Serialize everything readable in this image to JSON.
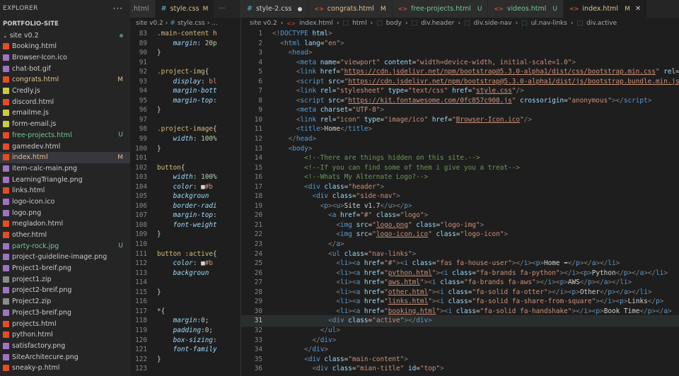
{
  "explorer": {
    "title": "EXPLORER",
    "more": "···",
    "project": "PORTFOLIO-SITE",
    "folder": "site v0.2",
    "files": [
      {
        "name": "Booking.html",
        "icon": "html",
        "status": ""
      },
      {
        "name": "Browser-Icon.ico",
        "icon": "img",
        "status": ""
      },
      {
        "name": "chat-bot.gif",
        "icon": "img",
        "status": ""
      },
      {
        "name": "congrats.html",
        "icon": "html",
        "status": "M"
      },
      {
        "name": "Credly.js",
        "icon": "js",
        "status": ""
      },
      {
        "name": "discord.html",
        "icon": "html",
        "status": ""
      },
      {
        "name": "emailme.js",
        "icon": "js",
        "status": ""
      },
      {
        "name": "form-email.js",
        "icon": "js",
        "status": ""
      },
      {
        "name": "free-projects.html",
        "icon": "html",
        "status": "U"
      },
      {
        "name": "gamedev.html",
        "icon": "html",
        "status": ""
      },
      {
        "name": "index.html",
        "icon": "html",
        "status": "M"
      },
      {
        "name": "item-calc-main.png",
        "icon": "img",
        "status": ""
      },
      {
        "name": "LearningTriangle.png",
        "icon": "img",
        "status": ""
      },
      {
        "name": "links.html",
        "icon": "html",
        "status": ""
      },
      {
        "name": "logo-icon.ico",
        "icon": "img",
        "status": ""
      },
      {
        "name": "logo.png",
        "icon": "img",
        "status": ""
      },
      {
        "name": "megladon.html",
        "icon": "html",
        "status": ""
      },
      {
        "name": "other.html",
        "icon": "html",
        "status": ""
      },
      {
        "name": "party-rock.jpg",
        "icon": "img",
        "status": "U"
      },
      {
        "name": "project-guideline-image.png",
        "icon": "img",
        "status": ""
      },
      {
        "name": "Project1-breif.png",
        "icon": "img",
        "status": ""
      },
      {
        "name": "project1.zip",
        "icon": "zip",
        "status": ""
      },
      {
        "name": "project2-breif.png",
        "icon": "img",
        "status": ""
      },
      {
        "name": "Project2.zip",
        "icon": "zip",
        "status": ""
      },
      {
        "name": "Project3-breif.png",
        "icon": "img",
        "status": ""
      },
      {
        "name": "projects.html",
        "icon": "html",
        "status": ""
      },
      {
        "name": "python.html",
        "icon": "html",
        "status": ""
      },
      {
        "name": "satisfactory.png",
        "icon": "img",
        "status": ""
      },
      {
        "name": "SiteArchitecure.png",
        "icon": "img",
        "status": ""
      },
      {
        "name": "sneaky-p.html",
        "icon": "html",
        "status": ""
      }
    ]
  },
  "left_editor": {
    "tabs": [
      {
        "label": ".html",
        "mark": "",
        "active": false
      },
      {
        "label": "style.css",
        "mark": "M",
        "active": true
      }
    ],
    "overflow": "···",
    "breadcrumb": [
      "site v0.2",
      "#",
      "style.css",
      "..."
    ],
    "lines": [
      {
        "n": "83",
        "h": "<span class='sel'>.main-content h</span>"
      },
      {
        "n": "89",
        "h": "    <span class='pr'>margin</span>: <span class='num'>20p</span>"
      },
      {
        "n": "90",
        "h": "<span class='tx'>}</span>"
      },
      {
        "n": "91",
        "h": ""
      },
      {
        "n": "92",
        "h": "<span class='sel'>.project-img</span><span class='tx'>{</span>"
      },
      {
        "n": "93",
        "h": "    <span class='pr'>display</span>: <span class='v'>bl</span>"
      },
      {
        "n": "94",
        "h": "    <span class='pr'>margin-bott</span>"
      },
      {
        "n": "95",
        "h": "    <span class='pr'>margin-top</span>:"
      },
      {
        "n": "96",
        "h": "<span class='tx'>}</span>"
      },
      {
        "n": "97",
        "h": ""
      },
      {
        "n": "98",
        "h": "<span class='sel'>.project-image</span><span class='tx'>{</span>"
      },
      {
        "n": "99",
        "h": "    <span class='pr'>width</span>: <span class='num'>100%</span>"
      },
      {
        "n": "100",
        "h": "<span class='tx'>}</span>"
      },
      {
        "n": "101",
        "h": ""
      },
      {
        "n": "102",
        "h": "<span class='sel'>button</span><span class='tx'>{</span>"
      },
      {
        "n": "103",
        "h": "    <span class='pr'>width</span>: <span class='num'>100%</span>"
      },
      {
        "n": "104",
        "h": "    <span class='pr'>color</span>: <span class='tx'>■</span><span class='v'>#b</span>"
      },
      {
        "n": "105",
        "h": "    <span class='pr'>backgroun</span>"
      },
      {
        "n": "106",
        "h": "    <span class='pr'>border-radi</span>"
      },
      {
        "n": "107",
        "h": "    <span class='pr'>margin-top</span>:"
      },
      {
        "n": "108",
        "h": "    <span class='pr'>font-weight</span>"
      },
      {
        "n": "109",
        "h": "<span class='tx'>}</span>"
      },
      {
        "n": "110",
        "h": ""
      },
      {
        "n": "111",
        "h": "<span class='sel'>button :active</span><span class='tx'>{</span>"
      },
      {
        "n": "112",
        "h": "    <span class='pr'>color</span>: <span class='tx'>■</span><span class='v'>#b</span>"
      },
      {
        "n": "113",
        "h": "    <span class='pr'>backgroun</span>"
      },
      {
        "n": "114",
        "h": ""
      },
      {
        "n": "115",
        "h": "<span class='tx'>}</span>"
      },
      {
        "n": "116",
        "h": ""
      },
      {
        "n": "117",
        "h": "<span class='sel'>*</span><span class='tx'>{</span>"
      },
      {
        "n": "118",
        "h": "    <span class='pr'>margin</span>:<span class='num'>0</span>;"
      },
      {
        "n": "119",
        "h": "    <span class='pr'>padding</span>:<span class='num'>0</span>;"
      },
      {
        "n": "120",
        "h": "    <span class='pr'>box-sizing</span>:"
      },
      {
        "n": "121",
        "h": "    <span class='pr'>font-family</span>"
      },
      {
        "n": "122",
        "h": "<span class='tx'>}</span>"
      },
      {
        "n": "123",
        "h": ""
      }
    ]
  },
  "right_editor": {
    "tabs": [
      {
        "label": "style-2.css",
        "mark": "●",
        "kind": "css",
        "active": false
      },
      {
        "label": "congrats.html",
        "mark": "M",
        "kind": "html",
        "active": false
      },
      {
        "label": "free-projects.html",
        "mark": "U",
        "kind": "html",
        "active": false
      },
      {
        "label": "videos.html",
        "mark": "U",
        "kind": "html",
        "active": false
      },
      {
        "label": "index.html",
        "mark": "M",
        "kind": "html",
        "active": true
      }
    ],
    "close": "✕",
    "breadcrumb": [
      "site v0.2",
      "index.html",
      "html",
      "body",
      "div.header",
      "div.side-nav",
      "ul.nav-links",
      "div.active"
    ],
    "current_line": "31",
    "lines": [
      {
        "n": "1",
        "h": "<span class='p'>&lt;!</span><span class='t'>DOCTYPE</span> <span class='a'>html</span><span class='p'>&gt;</span>"
      },
      {
        "n": "2",
        "h": "  <span class='p'>&lt;</span><span class='t'>html</span> <span class='a'>lang</span><span class='tx'>=</span><span class='s'>\"en\"</span><span class='p'>&gt;</span>"
      },
      {
        "n": "3",
        "h": "    <span class='p'>&lt;</span><span class='t'>head</span><span class='p'>&gt;</span>"
      },
      {
        "n": "4",
        "h": "      <span class='p'>&lt;</span><span class='t'>meta</span> <span class='a'>name</span><span class='tx'>=</span><span class='s'>\"viewport\"</span> <span class='a'>content</span><span class='tx'>=</span><span class='s'>\"width=device-width, initial-scale=1.0\"</span><span class='p'>&gt;</span>"
      },
      {
        "n": "5",
        "h": "      <span class='p'>&lt;</span><span class='t'>link</span> <span class='a'>href</span><span class='tx'>=</span><span class='s'>\"<span class='u'>https://cdn.jsdelivr.net/npm/bootstrap@5.3.0-alpha1/dist/css/bootstrap.min.css</span>\"</span> <span class='a'>rel</span>="
      },
      {
        "n": "6",
        "h": "      <span class='p'>&lt;</span><span class='t'>script</span> <span class='a'>src</span><span class='tx'>=</span><span class='s'>\"<span class='u'>https://cdn.jsdelivr.net/npm/bootstrap@5.3.0-alpha1/dist/js/bootstrap.bundle.min.js</span></span>"
      },
      {
        "n": "7",
        "h": "      <span class='p'>&lt;</span><span class='t'>link</span> <span class='a'>rel</span><span class='tx'>=</span><span class='s'>\"stylesheet\"</span> <span class='a'>type</span><span class='tx'>=</span><span class='s'>\"text/css\"</span> <span class='a'>href</span><span class='tx'>=</span><span class='s'>\"<span class='u'>style.css</span>\"</span><span class='p'>/&gt;</span>"
      },
      {
        "n": "8",
        "h": "      <span class='p'>&lt;</span><span class='t'>script</span> <span class='a'>src</span><span class='tx'>=</span><span class='s'>\"<span class='u'>https://kit.fontawesome.com/0fc857c908.js</span>\"</span> <span class='a'>crossorigin</span><span class='tx'>=</span><span class='s'>\"anonymous\"</span><span class='p'>&gt;&lt;/</span><span class='t'>script</span><span class='p'>&gt;</span>"
      },
      {
        "n": "9",
        "h": "      <span class='p'>&lt;</span><span class='t'>meta</span> <span class='a'>charset</span><span class='tx'>=</span><span class='s'>\"UTF-8\"</span><span class='p'>&gt;</span>"
      },
      {
        "n": "10",
        "h": "      <span class='p'>&lt;</span><span class='t'>link</span> <span class='a'>rel</span><span class='tx'>=</span><span class='s'>\"icon\"</span> <span class='a'>type</span><span class='tx'>=</span><span class='s'>\"image/ico\"</span> <span class='a'>href</span><span class='tx'>=</span><span class='s'>\"<span class='u'>Browser-Icon.ico</span>\"</span><span class='p'>/&gt;</span>"
      },
      {
        "n": "11",
        "h": "      <span class='p'>&lt;</span><span class='t'>title</span><span class='p'>&gt;</span><span class='tx'>Home</span><span class='p'>&lt;/</span><span class='t'>title</span><span class='p'>&gt;</span>"
      },
      {
        "n": "12",
        "h": "    <span class='p'>&lt;/</span><span class='t'>head</span><span class='p'>&gt;</span>"
      },
      {
        "n": "13",
        "h": "    <span class='p'>&lt;</span><span class='t'>body</span><span class='p'>&gt;</span>"
      },
      {
        "n": "14",
        "h": "        <span class='c'>&lt;!--There are things hidden on this site.--&gt;</span>"
      },
      {
        "n": "15",
        "h": "        <span class='c'>&lt;!--If you can find some of them i give you a treat--&gt;</span>"
      },
      {
        "n": "16",
        "h": "        <span class='c'>&lt;!--Whats My Alternate Logo?--&gt;</span>"
      },
      {
        "n": "17",
        "h": "        <span class='p'>&lt;</span><span class='t'>div</span> <span class='a'>class</span><span class='tx'>=</span><span class='s'>\"header\"</span><span class='p'>&gt;</span>"
      },
      {
        "n": "18",
        "h": "          <span class='p'>&lt;</span><span class='t'>div</span> <span class='a'>class</span><span class='tx'>=</span><span class='s'>\"side-nav\"</span><span class='p'>&gt;</span>"
      },
      {
        "n": "19",
        "h": "            <span class='p'>&lt;</span><span class='t'>p</span><span class='p'>&gt;&lt;</span><span class='t'>u</span><span class='p'>&gt;</span><span class='tx'>Site v1.7</span><span class='p'>&lt;/</span><span class='t'>u</span><span class='p'>&gt;&lt;/</span><span class='t'>p</span><span class='p'>&gt;</span>"
      },
      {
        "n": "20",
        "h": "              <span class='p'>&lt;</span><span class='t'>a</span> <span class='a'>href</span><span class='tx'>=</span><span class='s'>\"#\"</span> <span class='a'>class</span><span class='tx'>=</span><span class='s'>\"logo\"</span><span class='p'>&gt;</span>"
      },
      {
        "n": "21",
        "h": "                <span class='p'>&lt;</span><span class='t'>img</span> <span class='a'>src</span><span class='tx'>=</span><span class='s'>\"<span class='u'>logo.png</span>\"</span> <span class='a'>class</span><span class='tx'>=</span><span class='s'>\"logo-img\"</span><span class='p'>&gt;</span>"
      },
      {
        "n": "22",
        "h": "                <span class='p'>&lt;</span><span class='t'>img</span> <span class='a'>src</span><span class='tx'>=</span><span class='s'>\"<span class='u'>logo-icon.ico</span>\"</span> <span class='a'>class</span><span class='tx'>=</span><span class='s'>\"logo-icon\"</span><span class='p'>&gt;</span>"
      },
      {
        "n": "23",
        "h": "              <span class='p'>&lt;/</span><span class='t'>a</span><span class='p'>&gt;</span>"
      },
      {
        "n": "24",
        "h": "              <span class='p'>&lt;</span><span class='t'>ul</span> <span class='a'>class</span><span class='tx'>=</span><span class='s'>\"nav-links\"</span><span class='p'>&gt;</span>"
      },
      {
        "n": "25",
        "h": "                <span class='p'>&lt;</span><span class='t'>li</span><span class='p'>&gt;&lt;</span><span class='t'>a</span> <span class='a'>href</span><span class='tx'>=</span><span class='s'>\"#\"</span><span class='p'>&gt;&lt;</span><span class='t'>i</span> <span class='a'>class</span><span class='tx'>=</span><span class='s'>\"fas fa-house-user\"</span><span class='p'>&gt;&lt;/</span><span class='t'>i</span><span class='p'>&gt;&lt;</span><span class='t'>p</span><span class='p'>&gt;</span><span class='tx'>Home ➡</span><span class='p'>&lt;/</span><span class='t'>p</span><span class='p'>&gt;&lt;/</span><span class='t'>a</span><span class='p'>&gt;&lt;/</span><span class='t'>li</span><span class='p'>&gt;</span>"
      },
      {
        "n": "26",
        "h": "                <span class='p'>&lt;</span><span class='t'>li</span><span class='p'>&gt;&lt;</span><span class='t'>a</span> <span class='a'>href</span><span class='tx'>=</span><span class='s'>\"<span class='u'>python.html</span>\"</span><span class='p'>&gt;&lt;</span><span class='t'>i</span> <span class='a'>class</span><span class='tx'>=</span><span class='s'>\"fa-brands fa-python\"</span><span class='p'>&gt;&lt;/</span><span class='t'>i</span><span class='p'>&gt;&lt;</span><span class='t'>p</span><span class='p'>&gt;</span><span class='tx'>Python</span><span class='p'>&lt;/</span><span class='t'>p</span><span class='p'>&gt;&lt;/</span><span class='t'>a</span><span class='p'>&gt;&lt;/</span><span class='t'>li</span><span class='p'>&gt;</span>"
      },
      {
        "n": "27",
        "h": "                <span class='p'>&lt;</span><span class='t'>li</span><span class='p'>&gt;&lt;</span><span class='t'>a</span> <span class='a'>href</span><span class='tx'>=</span><span class='s'>\"<span class='u'>aws.html</span>\"</span><span class='p'>&gt;&lt;</span><span class='t'>i</span> <span class='a'>class</span><span class='tx'>=</span><span class='s'>\"fa-brands fa-aws\"</span><span class='p'>&gt;&lt;/</span><span class='t'>i</span><span class='p'>&gt;&lt;</span><span class='t'>p</span><span class='p'>&gt;</span><span class='tx'>AWS</span><span class='p'>&lt;/</span><span class='t'>p</span><span class='p'>&gt;&lt;/</span><span class='t'>a</span><span class='p'>&gt;&lt;/</span><span class='t'>li</span><span class='p'>&gt;</span>"
      },
      {
        "n": "28",
        "h": "                <span class='p'>&lt;</span><span class='t'>li</span><span class='p'>&gt;&lt;</span><span class='t'>a</span> <span class='a'>href</span><span class='tx'>=</span><span class='s'>\"<span class='u'>other.html</span>\"</span><span class='p'>&gt;&lt;</span><span class='t'>i</span> <span class='a'>class</span><span class='tx'>=</span><span class='s'>\"fa-solid fa-otter\"</span><span class='p'>&gt;&lt;/</span><span class='t'>i</span><span class='p'>&gt;&lt;</span><span class='t'>p</span><span class='p'>&gt;</span><span class='tx'>Other</span><span class='p'>&lt;/</span><span class='t'>p</span><span class='p'>&gt;&lt;/</span><span class='t'>a</span><span class='p'>&gt;&lt;/</span><span class='t'>li</span><span class='p'>&gt;</span>"
      },
      {
        "n": "29",
        "h": "                <span class='p'>&lt;</span><span class='t'>li</span><span class='p'>&gt;&lt;</span><span class='t'>a</span> <span class='a'>href</span><span class='tx'>=</span><span class='s'>\"<span class='u'>links.html</span>\"</span><span class='p'>&gt;&lt;</span><span class='t'>i</span> <span class='a'>class</span><span class='tx'>=</span><span class='s'>\"fa-solid fa-share-from-square\"</span><span class='p'>&gt;&lt;/</span><span class='t'>i</span><span class='p'>&gt;&lt;</span><span class='t'>p</span><span class='p'>&gt;</span><span class='tx'>Links</span><span class='p'>&lt;/</span><span class='t'>p</span><span class='p'>&gt;</span>"
      },
      {
        "n": "30",
        "h": "                <span class='p'>&lt;</span><span class='t'>li</span><span class='p'>&gt;&lt;</span><span class='t'>a</span> <span class='a'>href</span><span class='tx'>=</span><span class='s'>\"<span class='u'>booking.html</span>\"</span><span class='p'>&gt;&lt;</span><span class='t'>i</span> <span class='a'>class</span><span class='tx'>=</span><span class='s'>\"fa-solid fa-handshake\"</span><span class='p'>&gt;&lt;/</span><span class='t'>i</span><span class='p'>&gt;&lt;</span><span class='t'>p</span><span class='p'>&gt;</span><span class='tx'>Book Time</span><span class='p'>&lt;/</span><span class='t'>p</span><span class='p'>&gt;&lt;/</span><span class='t'>a</span><span class='p'>&gt;</span>"
      },
      {
        "n": "31",
        "h": "              <span class='p'>&lt;</span><span class='t'>div</span> <span class='a'>class</span><span class='tx'>=</span><span class='s'>\"active\"</span><span class='p'>&gt;&lt;/</span><span class='t'>div</span><span class='p'>&gt;</span>"
      },
      {
        "n": "32",
        "h": "            <span class='p'>&lt;/</span><span class='t'>ul</span><span class='p'>&gt;</span>"
      },
      {
        "n": "33",
        "h": "          <span class='p'>&lt;/</span><span class='t'>div</span><span class='p'>&gt;</span>"
      },
      {
        "n": "34",
        "h": "        <span class='p'>&lt;/</span><span class='t'>div</span><span class='p'>&gt;</span>"
      },
      {
        "n": "35",
        "h": "        <span class='p'>&lt;</span><span class='t'>div</span> <span class='a'>class</span><span class='tx'>=</span><span class='s'>\"main-content\"</span><span class='p'>&gt;</span>"
      },
      {
        "n": "36",
        "h": "          <span class='p'>&lt;</span><span class='t'>div</span> <span class='a'>class</span><span class='tx'>=</span><span class='s'>\"mian-title\"</span> <span class='a'>id</span><span class='tx'>=</span><span class='s'>\"top\"</span><span class='p'>&gt;</span>"
      }
    ]
  },
  "colors": {
    "modified": "#e2c08d",
    "untracked": "#73c991",
    "html_icon": "#e44d26",
    "js_icon": "#cbcb41",
    "img_icon": "#a074c4",
    "zip_icon": "#8b8b8b",
    "css_icon": "#519aba"
  }
}
